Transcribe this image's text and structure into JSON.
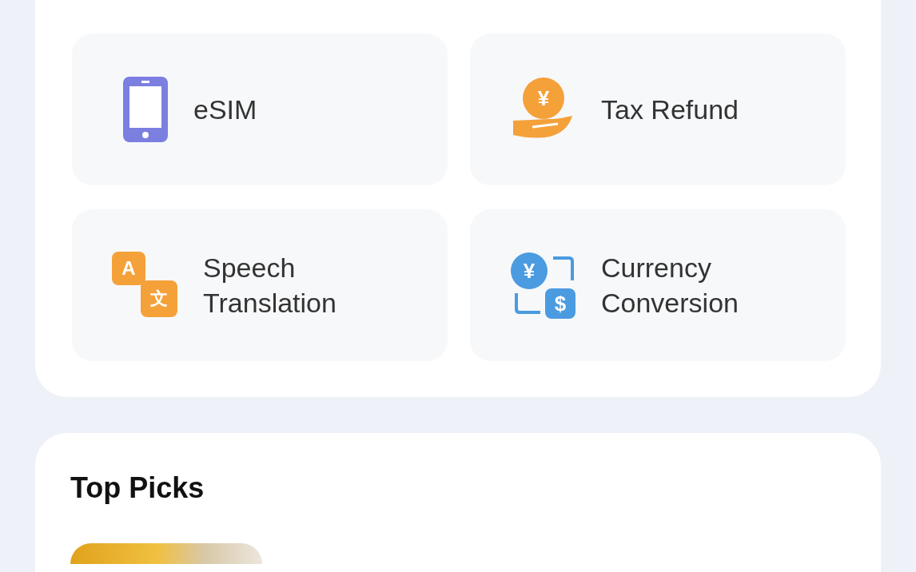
{
  "services": [
    {
      "kind": "phone",
      "label": "eSIM"
    },
    {
      "kind": "coin-hand",
      "label": "Tax Refund",
      "glyphs": [
        "¥"
      ]
    },
    {
      "kind": "translate",
      "label": "Speech Translation",
      "glyphs": [
        "A",
        "文"
      ]
    },
    {
      "kind": "exchange",
      "label": "Currency Conversion",
      "glyphs": [
        "¥",
        "$"
      ]
    }
  ],
  "top_picks": {
    "title": "Top Picks"
  }
}
